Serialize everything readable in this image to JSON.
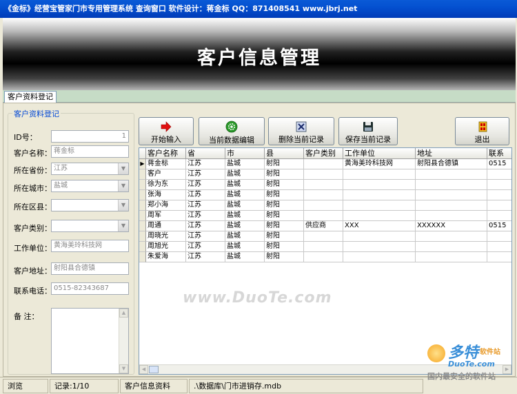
{
  "window": {
    "title": "《金标》经营宝管家门市专用管理系统  查询窗口    软件设计：蒋金标    QQ：871408541    www.jbrj.net"
  },
  "banner": {
    "title": "客户信息管理"
  },
  "tabs": [
    {
      "label": "客户资料登记",
      "active": true
    }
  ],
  "form": {
    "legend": "客户资料登记",
    "fields": {
      "id": {
        "label": "ID号：",
        "value": "1"
      },
      "name": {
        "label": "客户名称：",
        "value": "蒋金标"
      },
      "province": {
        "label": "所在省份：",
        "value": "江苏"
      },
      "city": {
        "label": "所在城市：",
        "value": "盐城"
      },
      "county": {
        "label": "所在区县：",
        "value": ""
      },
      "category": {
        "label": "客户类别：",
        "value": ""
      },
      "company": {
        "label": "工作单位：",
        "value": "黄海美玲科技网"
      },
      "address": {
        "label": "客户地址：",
        "value": "射阳县合德镇"
      },
      "phone": {
        "label": "联系电话：",
        "value": "0515-82343687"
      },
      "notes": {
        "label": "备    注：",
        "value": ""
      }
    }
  },
  "toolbar": {
    "start_label": "开始输入",
    "edit_label": "当前数据编辑",
    "delete_label": "删除当前记录",
    "save_label": "保存当前记录",
    "exit_label": "退出"
  },
  "icons": {
    "start": "red-arrow-right-icon",
    "edit": "green-gear-icon",
    "delete": "delete-record-icon",
    "save": "floppy-disk-icon",
    "exit": "exit-door-icon"
  },
  "table": {
    "columns": [
      "客户名称",
      "省",
      "市",
      "县",
      "客户类别",
      "工作单位",
      "地址",
      "联系"
    ],
    "rows": [
      [
        "蒋金标",
        "江苏",
        "盐城",
        "射阳",
        "",
        "黄海美玲科技网",
        "射阳县合德镇",
        "0515"
      ],
      [
        "客户",
        "江苏",
        "盐城",
        "射阳",
        "",
        "",
        "",
        ""
      ],
      [
        "徐为东",
        "江苏",
        "盐城",
        "射阳",
        "",
        "",
        "",
        ""
      ],
      [
        "张海",
        "江苏",
        "盐城",
        "射阳",
        "",
        "",
        "",
        ""
      ],
      [
        "郑小海",
        "江苏",
        "盐城",
        "射阳",
        "",
        "",
        "",
        ""
      ],
      [
        "周军",
        "江苏",
        "盐城",
        "射阳",
        "",
        "",
        "",
        ""
      ],
      [
        "周通",
        "江苏",
        "盐城",
        "射阳",
        "供应商",
        "XXX",
        "XXXXXX",
        "0515"
      ],
      [
        "周晓光",
        "江苏",
        "盐城",
        "射阳",
        "",
        "",
        "",
        ""
      ],
      [
        "周旭光",
        "江苏",
        "盐城",
        "射阳",
        "",
        "",
        "",
        ""
      ],
      [
        "朱爱海",
        "江苏",
        "盐城",
        "射阳",
        "",
        "",
        "",
        ""
      ]
    ],
    "current_row_marker": "▶"
  },
  "watermark": {
    "text": "www.DuoTe.com"
  },
  "statusbar": {
    "mode": "浏览",
    "record": "记录:1/10",
    "form_name": "客户信息资料",
    "db_path": ".\\数据库\\门市进销存.mdb"
  },
  "logo": {
    "big": "多特",
    "small": "软件站",
    "site": "DuoTe.com",
    "tagline": "国内最安全的软件站"
  },
  "colors": {
    "titlebar": "#0450d0",
    "legend": "#0046d5",
    "tabstrip": "#c6dcc6"
  }
}
